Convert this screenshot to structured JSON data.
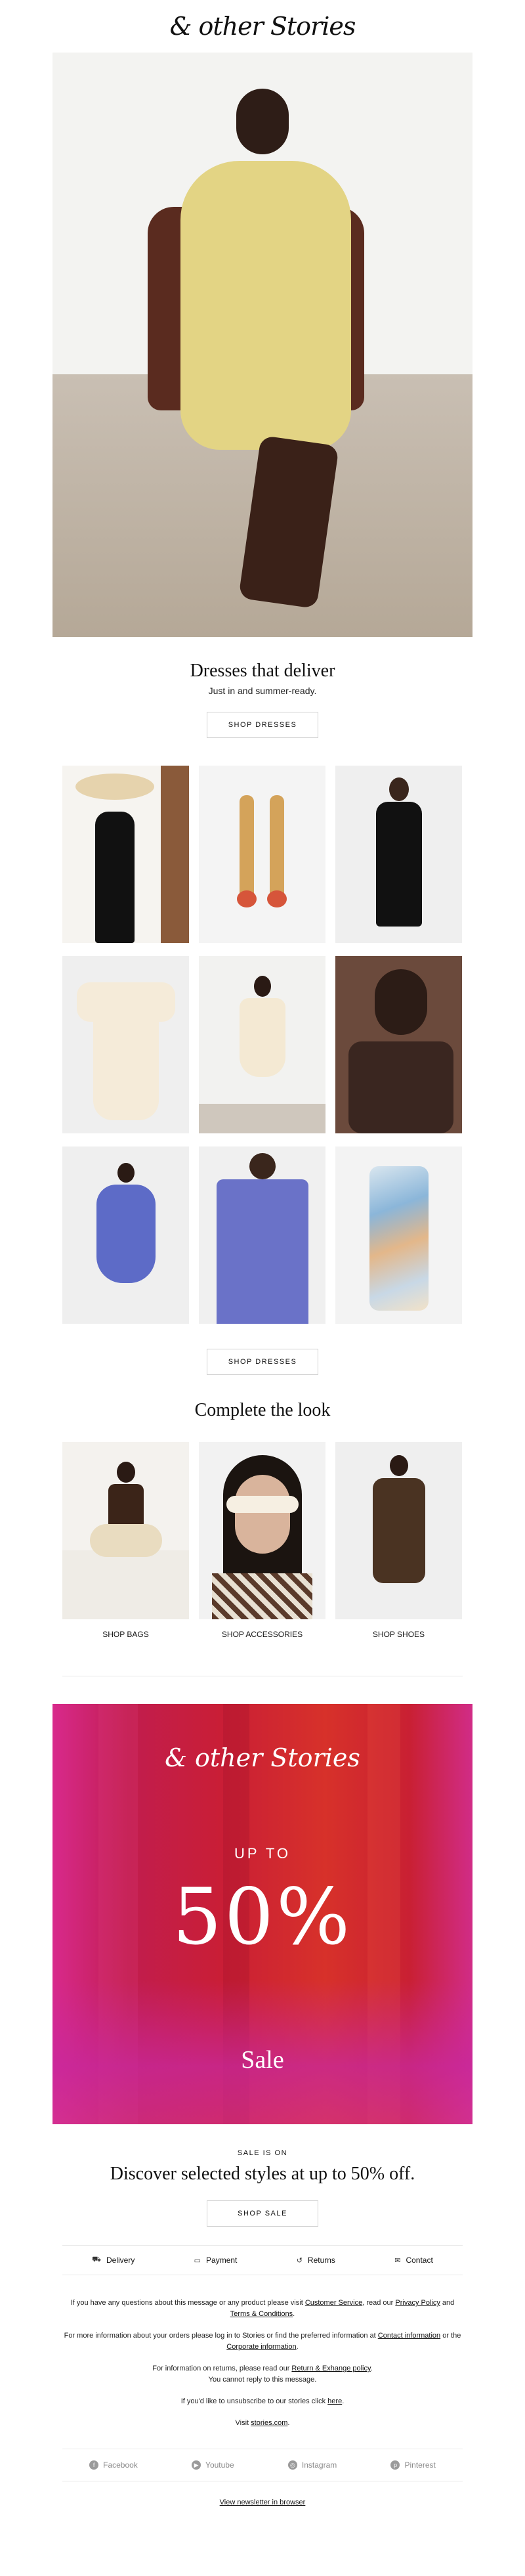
{
  "header": {
    "logo": "& other Stories"
  },
  "hero": {
    "image": "model in yellow lace dress seated in brown chair"
  },
  "dresses": {
    "title": "Dresses that deliver",
    "subtitle": "Just in and summer-ready.",
    "button": "SHOP DRESSES",
    "button_bottom": "SHOP DRESSES",
    "products": [
      {
        "name": "black-slip-dress-with-wide-hat"
      },
      {
        "name": "statement-drop-earrings"
      },
      {
        "name": "black-midi-dress"
      },
      {
        "name": "cream-mini-dress"
      },
      {
        "name": "cream-short-dress-on-model"
      },
      {
        "name": "brown-top-portrait"
      },
      {
        "name": "blue-puff-sleeve-midi-dress"
      },
      {
        "name": "blue-smocked-maxi-dress"
      },
      {
        "name": "printed-slip-dress"
      }
    ]
  },
  "look": {
    "title": "Complete the look",
    "items": [
      {
        "label": "SHOP BAGS"
      },
      {
        "label": "SHOP ACCESSORIES"
      },
      {
        "label": "SHOP SHOES"
      }
    ]
  },
  "sale_banner": {
    "logo": "& other Stories",
    "upto": "UP TO",
    "percent": "50%",
    "word": "Sale"
  },
  "sale": {
    "eyebrow": "SALE IS ON",
    "title": "Discover selected styles at up to 50% off.",
    "button": "SHOP SALE"
  },
  "services": [
    {
      "label": "Delivery",
      "icon": "delivery-truck-icon"
    },
    {
      "label": "Payment",
      "icon": "card-icon"
    },
    {
      "label": "Returns",
      "icon": "return-arrow-icon"
    },
    {
      "label": "Contact",
      "icon": "chat-icon"
    }
  ],
  "legal": {
    "p1_a": "If you have any questions about this message or any product please visit",
    "p1_link1": "Customer Service",
    "p1_b": ", read our",
    "p1_link2": "Privacy Policy",
    "p1_c": "and",
    "p1_link3": "Terms & Conditions",
    "p1_d": ".",
    "p2_a": "For more information about your orders please log in to Stories or find the preferred information at",
    "p2_link1": "Contact information",
    "p2_b": "or the",
    "p2_link2": "Corporate information",
    "p2_c": ".",
    "p3_a": "For information on returns, please read our",
    "p3_link": "Return & Exhange policy",
    "p3_b": ".",
    "p3_line2": "You cannot reply to this message.",
    "p4_a": "If you'd like to unsubscribe to our stories click",
    "p4_link": "here",
    "p4_b": ".",
    "p5_a": "Visit",
    "p5_link": "stories.com",
    "p5_b": "."
  },
  "social": [
    {
      "label": "Facebook",
      "glyph": "f"
    },
    {
      "label": "Youtube",
      "glyph": "▶"
    },
    {
      "label": "Instagram",
      "glyph": "◎"
    },
    {
      "label": "Pinterest",
      "glyph": "p"
    }
  ],
  "footer": {
    "browser_link": "View newsletter in browser"
  }
}
